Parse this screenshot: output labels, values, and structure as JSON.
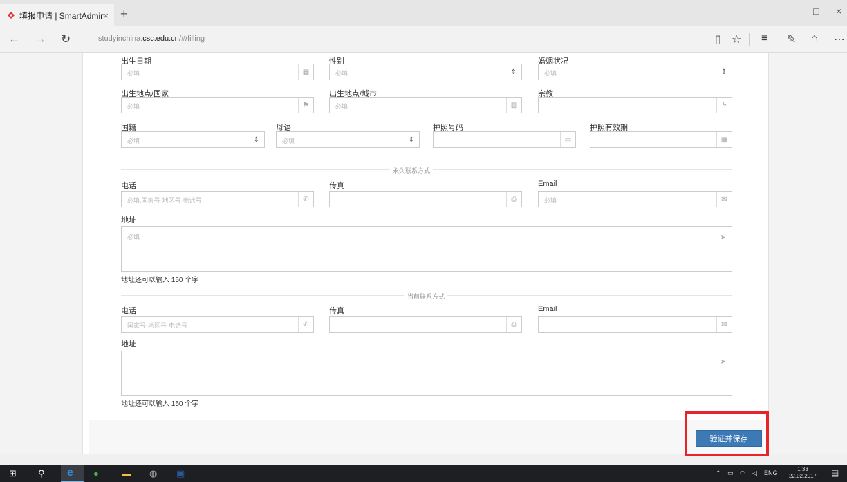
{
  "browser": {
    "tab_title": "填报申请 | SmartAdmin",
    "tab_close": "×",
    "new_tab": "+",
    "min": "—",
    "max": "□",
    "close": "×",
    "url_prefix": "studyinchina.",
    "url_domain": "csc.edu.cn",
    "url_path": "/#/filling"
  },
  "form": {
    "birth_date": {
      "label": "出生日期",
      "placeholder": "必填"
    },
    "gender": {
      "label": "性别",
      "placeholder": "必填"
    },
    "marital": {
      "label": "婚姻状况",
      "placeholder": "必填"
    },
    "birth_country": {
      "label": "出生地点/国家",
      "placeholder": "必填"
    },
    "birth_city": {
      "label": "出生地点/城市",
      "placeholder": "必填"
    },
    "religion": {
      "label": "宗教",
      "placeholder": ""
    },
    "nationality": {
      "label": "国籍",
      "placeholder": "必填"
    },
    "native_language": {
      "label": "母语",
      "placeholder": "必填"
    },
    "passport_no": {
      "label": "护照号码",
      "placeholder": ""
    },
    "passport_expiry": {
      "label": "护照有效期",
      "placeholder": ""
    }
  },
  "permanent": {
    "section_title": "永久联系方式",
    "phone": {
      "label": "电话",
      "placeholder": "必填,国家号-地区号-电话号"
    },
    "fax": {
      "label": "传真",
      "placeholder": ""
    },
    "email": {
      "label": "Email",
      "placeholder": "必填"
    },
    "address": {
      "label": "地址",
      "placeholder": "必填"
    },
    "hint": "地址还可以输入 150 个字"
  },
  "current": {
    "section_title": "当前联系方式",
    "phone": {
      "label": "电话",
      "placeholder": "国家号-地区号-电话号"
    },
    "fax": {
      "label": "传真",
      "placeholder": ""
    },
    "email": {
      "label": "Email",
      "placeholder": ""
    },
    "address": {
      "label": "地址",
      "placeholder": ""
    },
    "hint": "地址还可以输入 150 个字"
  },
  "actions": {
    "save_label": "验证并保存"
  },
  "taskbar": {
    "lang": "ENG",
    "time": "1:33",
    "date": "22.02.2017"
  },
  "colors": {
    "accent": "#3d79b5",
    "highlight": "#e8242b"
  }
}
